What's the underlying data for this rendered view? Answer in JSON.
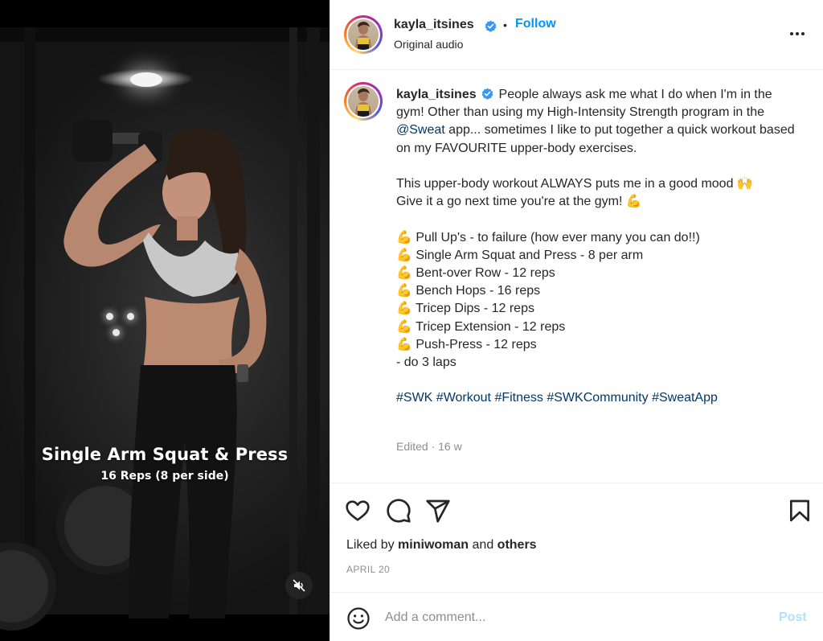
{
  "media": {
    "overlay_title": "Single Arm Squat & Press",
    "overlay_subtitle": "16 Reps (8 per side)",
    "mute_icon": "speaker-muted-icon"
  },
  "header": {
    "username": "kayla_itsines",
    "separator": "•",
    "follow_label": "Follow",
    "audio_label": "Original audio",
    "more_icon": "more-options-icon"
  },
  "post": {
    "username": "kayla_itsines",
    "caption_intro": "People always ask me what I do when I'm in the gym! Other than using my High-Intensity Strength program in the ",
    "mention": "@Sweat",
    "caption_after_mention": " app... sometimes I like to put together a quick workout based on my FAVOURITE upper-body exercises.",
    "line_mood": "This upper-body workout ALWAYS puts me in a good mood 🙌",
    "line_give": "Give it a go next time you're at the gym! 💪",
    "exercises": [
      "💪 Pull Up's - to failure (how ever many you can do!!)",
      "💪 Single Arm Squat and Press - 8 per arm",
      "💪 Bent-over Row - 12 reps",
      "💪 Bench Hops - 16 reps",
      "💪 Tricep Dips - 12 reps",
      "💪 Tricep Extension - 12 reps",
      "💪 Push-Press - 12 reps",
      "- do 3 laps"
    ],
    "hashtags": [
      "#SWK",
      "#Workout",
      "#Fitness",
      "#SWKCommunity",
      "#SweatApp"
    ],
    "meta": "Edited · 16 w"
  },
  "engagement": {
    "liked_prefix": "Liked by",
    "liked_user": "miniwoman",
    "liked_and": "and",
    "liked_others": "others",
    "date": "APRIL 20"
  },
  "comment": {
    "placeholder": "Add a comment...",
    "post_label": "Post"
  },
  "colors": {
    "link_blue": "#0095f6",
    "hashtag": "#00376b",
    "muted_text": "#8e8e8e",
    "post_disabled": "#b2dffc",
    "verified": "#3897f0"
  }
}
